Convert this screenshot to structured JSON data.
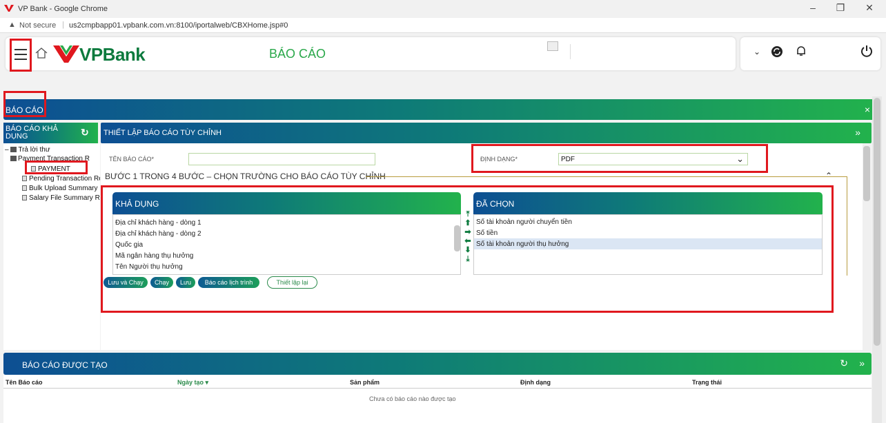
{
  "browser": {
    "window_title": "VP Bank - Google Chrome",
    "security_label": "Not secure",
    "url": "us2cmpbapp01.vpbank.com.vn:8100/iportalweb/CBXHome.jsp#0",
    "minimize": "–",
    "restore": "❐",
    "close": "✕"
  },
  "header": {
    "brand": "VPBank",
    "page_title": "BÁO CÁO"
  },
  "section": {
    "title": "BÁO CÁO",
    "close": "×"
  },
  "left_panel": {
    "title": "BÁO CÁO KHẢ DỤNG",
    "tree": [
      {
        "label": "Trả lời thư"
      },
      {
        "label": "Payment Transaction R"
      },
      {
        "label": "PAYMENT"
      },
      {
        "label": "Pending Transaction Re"
      },
      {
        "label": "Bulk Upload Summary"
      },
      {
        "label": "Salary File Summary Re"
      }
    ]
  },
  "main_panel": {
    "title": "THIẾT LẬP BÁO CÁO TÙY CHỈNH",
    "expand": "»",
    "report_name_label": "TÊN BÁO CÁO*",
    "report_name_value": "",
    "format_label": "ĐỊNH DẠNG*",
    "format_value": "PDF",
    "step_title": "BƯỚC 1 TRONG 4 BƯỚC – CHỌN TRƯỜNG CHO BÁO CÁO TÙY CHỈNH",
    "available_header": "KHẢ DỤNG",
    "available_items": [
      "Địa chỉ khách hàng - dòng 1",
      "Địa chỉ khách hàng - dòng 2",
      "Quốc gia",
      "Mã ngân hàng thụ hưởng",
      "Tên Người thụ hưởng"
    ],
    "selected_header": "ĐÃ CHỌN",
    "selected_items": [
      "Số tài khoản người chuyển tiền",
      "Số tiền",
      "Số tài khoản người thụ hưởng"
    ],
    "buttons": {
      "save_run": "Lưu và Chạy",
      "run": "Chạy",
      "save": "Lưu",
      "schedule": "Báo cáo lịch trình",
      "reset": "Thiết lập lại"
    }
  },
  "bottom_panel": {
    "title": "BÁO CÁO ĐƯỢC TẠO",
    "columns": [
      "Tên Báo cáo",
      "Ngày tạo ▾",
      "Sản phẩm",
      "Định dạng",
      "Trạng thái"
    ],
    "empty_message": "Chưa có báo cáo nào được tạo"
  },
  "colors": {
    "brand_green": "#0c7a3d",
    "brand_red": "#e0181e",
    "accent_green": "#2aa84a",
    "header_blue": "#0d4f93"
  }
}
